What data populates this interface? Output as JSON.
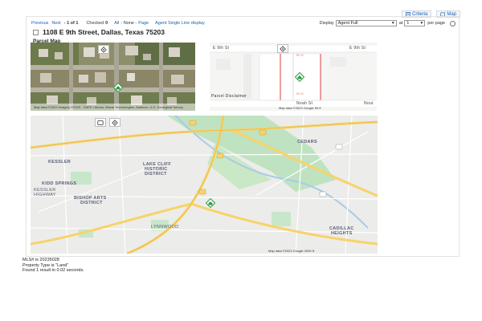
{
  "tabs": [
    {
      "label": "Criteria",
      "icon": "criteria-icon"
    },
    {
      "label": "Map",
      "icon": "map-icon"
    }
  ],
  "toolbar": {
    "previous": "Previous",
    "next": "Next",
    "page_of": "- 1 of 1",
    "checked_label": "Checked",
    "checked_count": "0",
    "all": "All",
    "none": "- None -",
    "page": "Page",
    "display_mode": "Agent Single Line display",
    "display_label": "Display",
    "display_value": "Agent Full",
    "at_label": "at",
    "per_page_value": "1",
    "per_page_label": "per page"
  },
  "listing": {
    "address": "1108 E 9th Street, Dallas, Texas 75203",
    "section_title": "Parcel Map"
  },
  "maps": {
    "aerial_attribution": "Map data ©2023 Imagery ©2023 , CNES / Airbus, Maxar Technologies, Sanborn, U.S. Geological Survey",
    "parcel": {
      "street_left": "E 9th St",
      "street_right": "E 9th St",
      "noah_label": "Noah St",
      "parcel_disclaimer": "Parcel Disclaimer",
      "attribution": "Map data ©2023 Google 50 ft",
      "dim_top": "50 ft",
      "dim_bottom": "50 ft",
      "right_edge": "Nout"
    },
    "road": {
      "labels": {
        "cedars": "CEDARS",
        "kessler": "KESSLER",
        "lakecliff": "LAKE CLIFF",
        "historic": "HISTORIC",
        "district": "DISTRICT",
        "kidd": "KIDD SPRINGS",
        "kessler2": "KESSLER",
        "highway": "HIGHWAY",
        "bishop": "BISHOP ARTS",
        "district2": "DISTRICT",
        "cadillac": "CADILLAC",
        "heights": "HEIGHTS",
        "lynnwood": "LYNNWOOD"
      },
      "attribution": "Map data ©2023 Google 2000 ft"
    }
  },
  "footer": {
    "line1": "MLS# is 20235028",
    "line2": "Property Type is \"Land\"",
    "line3": "Found 1 result in 0.02 seconds."
  },
  "colors": {
    "link": "#1a5fb4",
    "park_green": "#bfe3c0",
    "highway_yellow": "#f7d36a",
    "parcel_red": "#e36a6a",
    "marker_green": "#2f9e44"
  }
}
